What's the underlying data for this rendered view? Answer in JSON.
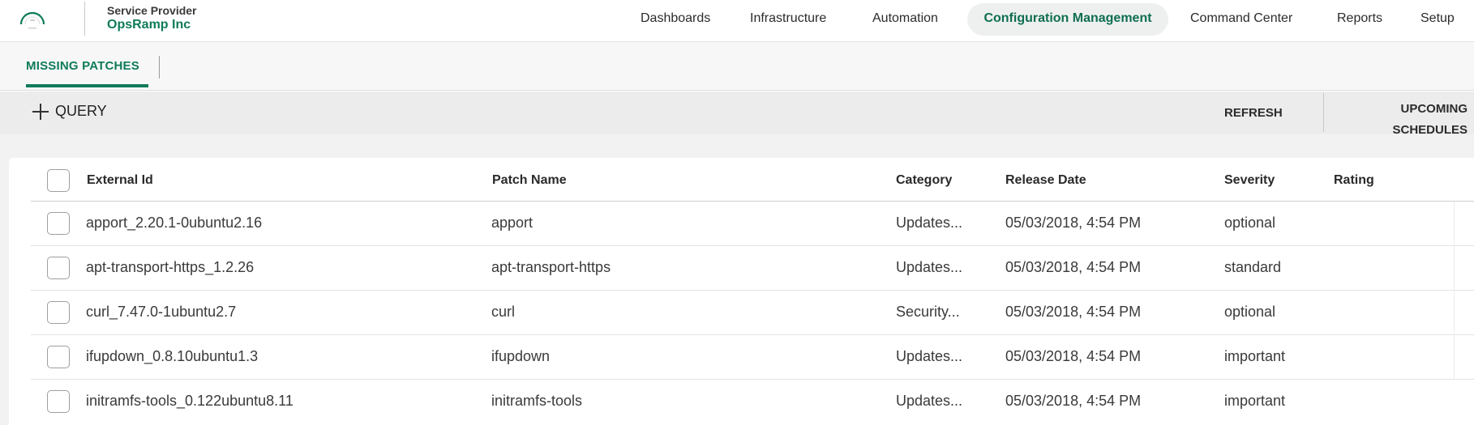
{
  "brand": {
    "subtitle": "Service Provider",
    "name": "OpsRamp Inc"
  },
  "nav": {
    "items": [
      {
        "label": "Dashboards",
        "active": false
      },
      {
        "label": "Infrastructure",
        "active": false
      },
      {
        "label": "Automation",
        "active": false
      },
      {
        "label": "Configuration Management",
        "active": true
      },
      {
        "label": "Command Center",
        "active": false
      },
      {
        "label": "Reports",
        "active": false
      },
      {
        "label": "Setup",
        "active": false
      }
    ]
  },
  "tabs": {
    "active_label": "MISSING PATCHES"
  },
  "actions": {
    "query_label": "QUERY",
    "refresh_label": "REFRESH",
    "upcoming_line1": "UPCOMING",
    "upcoming_line2": "SCHEDULES"
  },
  "table": {
    "columns": {
      "external_id": "External Id",
      "patch_name": "Patch Name",
      "category": "Category",
      "release_date": "Release Date",
      "severity": "Severity",
      "rating": "Rating"
    },
    "rows": [
      {
        "external_id": "apport_2.20.1-0ubuntu2.16",
        "patch_name": "apport",
        "category": "Updates...",
        "release_date": "05/03/2018, 4:54 PM",
        "severity": "optional",
        "rating": ""
      },
      {
        "external_id": "apt-transport-https_1.2.26",
        "patch_name": "apt-transport-https",
        "category": "Updates...",
        "release_date": "05/03/2018, 4:54 PM",
        "severity": "standard",
        "rating": ""
      },
      {
        "external_id": "curl_7.47.0-1ubuntu2.7",
        "patch_name": "curl",
        "category": "Security...",
        "release_date": "05/03/2018, 4:54 PM",
        "severity": "optional",
        "rating": ""
      },
      {
        "external_id": "ifupdown_0.8.10ubuntu1.3",
        "patch_name": "ifupdown",
        "category": "Updates...",
        "release_date": "05/03/2018, 4:54 PM",
        "severity": "important",
        "rating": ""
      },
      {
        "external_id": "initramfs-tools_0.122ubuntu8.11",
        "patch_name": "initramfs-tools",
        "category": "Updates...",
        "release_date": "05/03/2018, 4:54 PM",
        "severity": "important",
        "rating": ""
      }
    ]
  },
  "colors": {
    "brand_green": "#0f7b5a",
    "active_nav_bg": "#eef0f0"
  }
}
